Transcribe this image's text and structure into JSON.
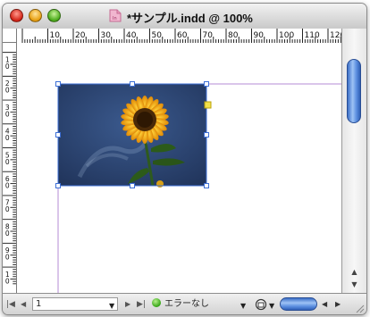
{
  "window": {
    "title": "*サンプル.indd @ 100%",
    "traffic_lights": {
      "close": "×",
      "minimize": "−",
      "zoom": "+"
    }
  },
  "rulers": {
    "horizontal_labels": [
      "10",
      "20",
      "30",
      "40",
      "50",
      "60",
      "70",
      "80",
      "90",
      "100",
      "110",
      "120",
      "13"
    ],
    "vertical_labels": [
      "1\n0",
      "2\n0",
      "3\n0",
      "4\n0",
      "5\n0",
      "6\n0",
      "7\n0",
      "8\n0",
      "9\n0",
      "1\n0"
    ]
  },
  "status_bar": {
    "page_number": "1",
    "preflight_status": "エラーなし"
  },
  "icons": {
    "first_page": "first-page-icon",
    "prev_page": "previous-page-icon",
    "next_page": "next-page-icon",
    "last_page": "last-page-icon",
    "page_menu": "dropdown-arrow-icon",
    "preflight_ok": "green-status-icon",
    "preflight_menu": "dropdown-arrow-icon",
    "open_folder": "open-icon",
    "scroll_up": "up-arrow-icon",
    "scroll_down": "down-arrow-icon",
    "scroll_left": "left-arrow-icon",
    "scroll_right": "right-arrow-icon",
    "resize": "resize-grip-icon"
  },
  "colors": {
    "guide": "#b58bd4",
    "frame_selection": "#3d6fd6",
    "thumb_blue": "#4a7fd6",
    "preflight_ok": "#33a414"
  }
}
